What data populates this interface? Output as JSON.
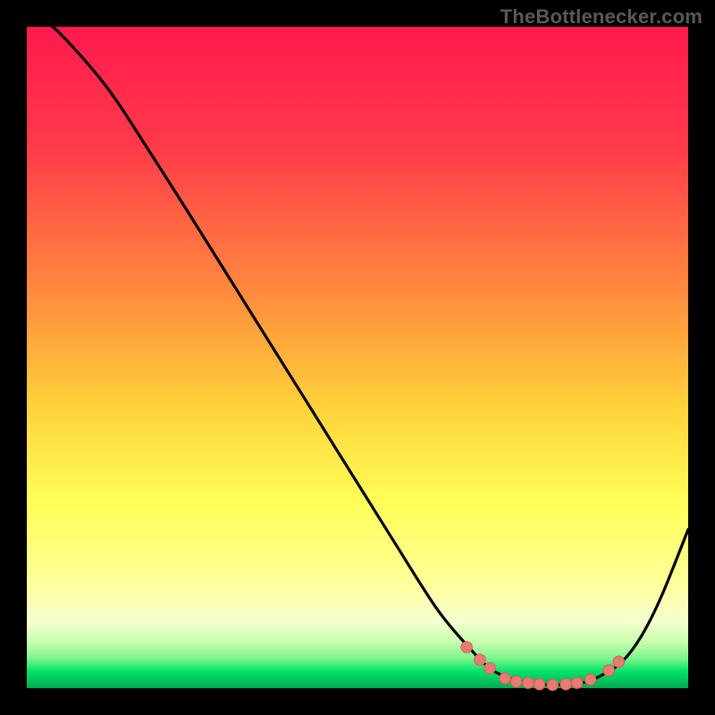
{
  "watermark": "TheBottlenecker.com",
  "colors": {
    "page_bg": "#000000",
    "curve": "#000000",
    "dot_fill": "#e97b72",
    "dot_stroke": "#d45e58",
    "gradient_top": "#ff1a4e",
    "gradient_low_orange": "#ffb13b",
    "gradient_yellow": "#ffff58",
    "gradient_pale_yellow": "#ffffa3",
    "gradient_green": "#00e36a",
    "gradient_deep_green": "#00a850"
  },
  "chart_data": {
    "type": "line",
    "title": "",
    "xlabel": "",
    "ylabel": "",
    "xlim": [
      0,
      100
    ],
    "ylim": [
      0,
      100
    ],
    "curve": [
      {
        "x": 0,
        "y": 103
      },
      {
        "x": 5,
        "y": 99
      },
      {
        "x": 12,
        "y": 91
      },
      {
        "x": 18,
        "y": 82
      },
      {
        "x": 25,
        "y": 71
      },
      {
        "x": 35,
        "y": 55
      },
      {
        "x": 45,
        "y": 39
      },
      {
        "x": 55,
        "y": 23
      },
      {
        "x": 62,
        "y": 12
      },
      {
        "x": 67,
        "y": 6
      },
      {
        "x": 70,
        "y": 3
      },
      {
        "x": 73,
        "y": 1.5
      },
      {
        "x": 76,
        "y": 0.8
      },
      {
        "x": 80,
        "y": 0.5
      },
      {
        "x": 84,
        "y": 0.8
      },
      {
        "x": 87,
        "y": 2
      },
      {
        "x": 90,
        "y": 4
      },
      {
        "x": 93,
        "y": 8
      },
      {
        "x": 96,
        "y": 14
      },
      {
        "x": 100,
        "y": 24
      }
    ],
    "dots": [
      {
        "x": 66.5,
        "y": 6.2
      },
      {
        "x": 68.5,
        "y": 4.3
      },
      {
        "x": 70.0,
        "y": 3.0
      },
      {
        "x": 72.3,
        "y": 1.5
      },
      {
        "x": 74.0,
        "y": 1.0
      },
      {
        "x": 75.8,
        "y": 0.8
      },
      {
        "x": 77.5,
        "y": 0.6
      },
      {
        "x": 79.5,
        "y": 0.5
      },
      {
        "x": 81.5,
        "y": 0.6
      },
      {
        "x": 83.2,
        "y": 0.8
      },
      {
        "x": 85.2,
        "y": 1.3
      },
      {
        "x": 88.0,
        "y": 2.7
      },
      {
        "x": 89.5,
        "y": 4.0
      }
    ]
  }
}
